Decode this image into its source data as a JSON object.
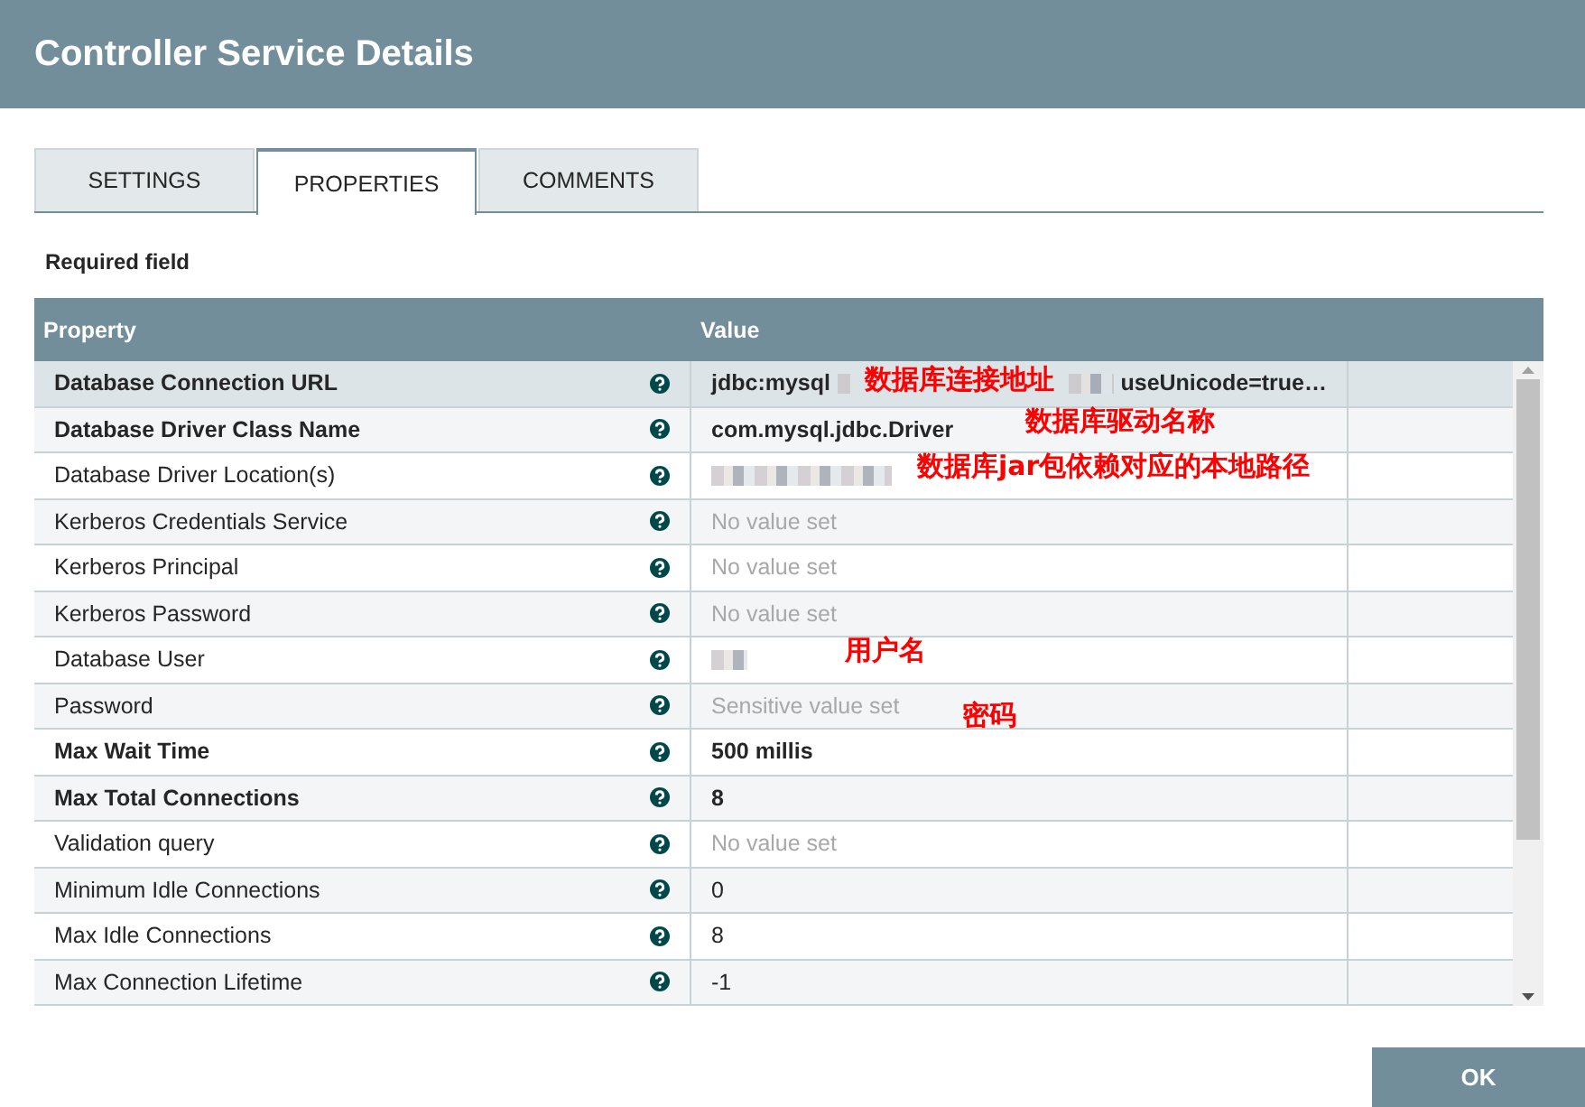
{
  "window": {
    "title": "Controller Service Details"
  },
  "tabs": [
    {
      "label": "SETTINGS",
      "selected": false
    },
    {
      "label": "PROPERTIES",
      "selected": true
    },
    {
      "label": "COMMENTS",
      "selected": false
    }
  ],
  "required_note": "Required field",
  "table": {
    "columns": [
      "Property",
      "Value"
    ],
    "rows": [
      {
        "name": "Database Connection URL",
        "required": true,
        "selected": true,
        "muted": false,
        "value": "jdbc:mysql",
        "redacted": true,
        "value_end": "useUnicode=true…",
        "note": "数据库连接地址"
      },
      {
        "name": "Database Driver Class Name",
        "required": true,
        "selected": false,
        "muted": false,
        "value": "com.mysql.jdbc.Driver",
        "redacted": false,
        "note": "数据库驱动名称"
      },
      {
        "name": "Database Driver Location(s)",
        "required": false,
        "selected": false,
        "redacted": true,
        "note": "数据库jar包依赖对应的本地路径"
      },
      {
        "name": "Kerberos Credentials Service",
        "required": false,
        "selected": false,
        "muted": true,
        "value": "No value set",
        "redacted": false
      },
      {
        "name": "Kerberos Principal",
        "required": false,
        "selected": false,
        "muted": true,
        "value": "No value set",
        "redacted": false
      },
      {
        "name": "Kerberos Password",
        "required": false,
        "selected": false,
        "muted": true,
        "value": "No value set",
        "redacted": false
      },
      {
        "name": "Database User",
        "required": false,
        "selected": false,
        "redacted": true,
        "note": "用户名"
      },
      {
        "name": "Password",
        "required": false,
        "selected": false,
        "muted": true,
        "value": "Sensitive value set",
        "redacted": false,
        "note": "密码"
      },
      {
        "name": "Max Wait Time",
        "required": true,
        "selected": false,
        "muted": false,
        "value": "500 millis",
        "redacted": false
      },
      {
        "name": "Max Total Connections",
        "required": true,
        "selected": false,
        "muted": false,
        "value": "8",
        "redacted": false
      },
      {
        "name": "Validation query",
        "required": false,
        "selected": false,
        "muted": true,
        "value": "No value set",
        "redacted": false
      },
      {
        "name": "Minimum Idle Connections",
        "required": false,
        "selected": false,
        "muted": false,
        "value": "0",
        "redacted": false
      },
      {
        "name": "Max Idle Connections",
        "required": false,
        "selected": false,
        "muted": false,
        "value": "8",
        "redacted": false
      },
      {
        "name": "Max Connection Lifetime",
        "required": false,
        "selected": false,
        "muted": false,
        "value": "-1",
        "redacted": false
      }
    ]
  },
  "buttons": [
    {
      "label": "OK"
    }
  ]
}
